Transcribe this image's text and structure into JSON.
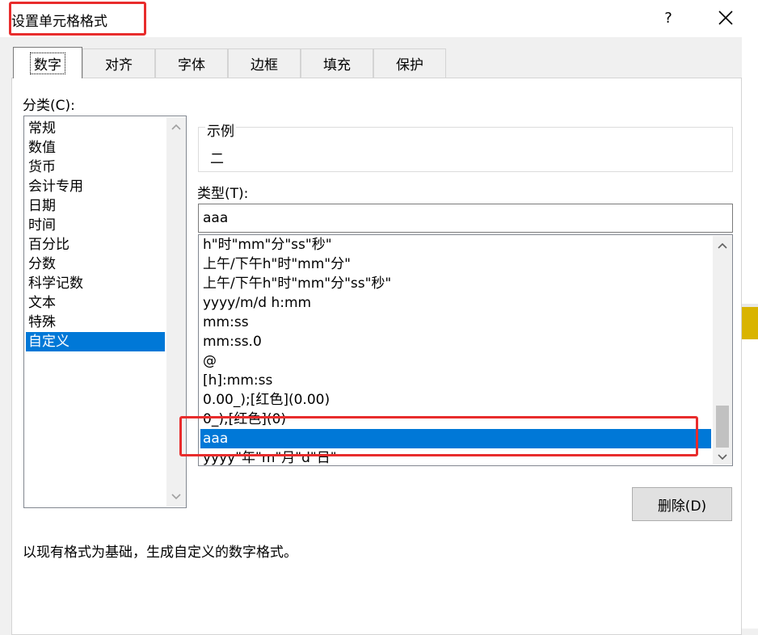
{
  "window": {
    "title": "设置单元格格式",
    "help_label": "?",
    "close_icon": "close-icon"
  },
  "tabs": [
    {
      "label": "数字",
      "active": true
    },
    {
      "label": "对齐",
      "active": false
    },
    {
      "label": "字体",
      "active": false
    },
    {
      "label": "边框",
      "active": false
    },
    {
      "label": "填充",
      "active": false
    },
    {
      "label": "保护",
      "active": false
    }
  ],
  "category": {
    "label": "分类(C):",
    "items": [
      "常规",
      "数值",
      "货币",
      "会计专用",
      "日期",
      "时间",
      "百分比",
      "分数",
      "科学记数",
      "文本",
      "特殊",
      "自定义"
    ],
    "selected": "自定义"
  },
  "sample": {
    "label": "示例",
    "value": "二"
  },
  "type": {
    "label": "类型(T):",
    "value": "aaa",
    "items": [
      "h\"时\"mm\"分\"ss\"秒\"",
      "上午/下午h\"时\"mm\"分\"",
      "上午/下午h\"时\"mm\"分\"ss\"秒\"",
      "yyyy/m/d h:mm",
      "mm:ss",
      "mm:ss.0",
      "@",
      "[h]:mm:ss",
      "0.00_);[红色](0.00)",
      "0_);[红色](0)",
      "aaa",
      "yyyy\"年\"m\"月\"d\"日\""
    ],
    "selected": "aaa"
  },
  "delete_button": {
    "label": "删除(D)"
  },
  "description": "以现有格式为基础，生成自定义的数字格式。",
  "colors": {
    "accent": "#0078d7",
    "annotation": "#e82c2c"
  }
}
